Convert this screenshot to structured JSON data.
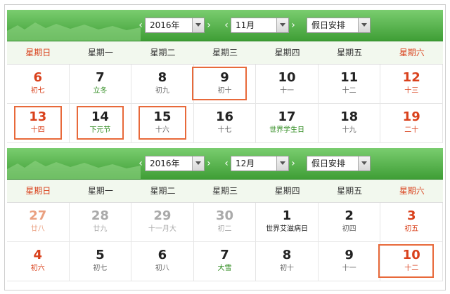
{
  "top": {
    "year": "2016年",
    "month": "11月",
    "holiday_label": "假日安排",
    "weekdays": [
      "星期日",
      "星期一",
      "星期二",
      "星期三",
      "星期四",
      "星期五",
      "星期六"
    ],
    "rows": [
      [
        {
          "day": "6",
          "lunar": "初七"
        },
        {
          "day": "7",
          "lunar": "立冬"
        },
        {
          "day": "8",
          "lunar": "初九"
        },
        {
          "day": "9",
          "lunar": "初十"
        },
        {
          "day": "10",
          "lunar": "十一"
        },
        {
          "day": "11",
          "lunar": "十二"
        },
        {
          "day": "12",
          "lunar": "十三"
        }
      ],
      [
        {
          "day": "13",
          "lunar": "十四"
        },
        {
          "day": "14",
          "lunar": "下元节"
        },
        {
          "day": "15",
          "lunar": "十六"
        },
        {
          "day": "16",
          "lunar": "十七"
        },
        {
          "day": "17",
          "lunar": "世界学生日"
        },
        {
          "day": "18",
          "lunar": "十九"
        },
        {
          "day": "19",
          "lunar": "二十"
        }
      ]
    ]
  },
  "bottom": {
    "year": "2016年",
    "month": "12月",
    "holiday_label": "假日安排",
    "weekdays": [
      "星期日",
      "星期一",
      "星期二",
      "星期三",
      "星期四",
      "星期五",
      "星期六"
    ],
    "rows": [
      [
        {
          "day": "27",
          "lunar": "廿八"
        },
        {
          "day": "28",
          "lunar": "廿九"
        },
        {
          "day": "29",
          "lunar": "十一月大"
        },
        {
          "day": "30",
          "lunar": "初二"
        },
        {
          "day": "1",
          "lunar": "世界艾滋病日"
        },
        {
          "day": "2",
          "lunar": "初四"
        },
        {
          "day": "3",
          "lunar": "初五"
        }
      ],
      [
        {
          "day": "4",
          "lunar": "初六"
        },
        {
          "day": "5",
          "lunar": "初七"
        },
        {
          "day": "6",
          "lunar": "初八"
        },
        {
          "day": "7",
          "lunar": "大雪"
        },
        {
          "day": "8",
          "lunar": "初十"
        },
        {
          "day": "9",
          "lunar": "十一"
        },
        {
          "day": "10",
          "lunar": "十二"
        }
      ]
    ]
  },
  "colors": {
    "header_green": "#4fae46",
    "weekend_red": "#d9411c",
    "highlight_orange": "#e8693a",
    "term_green": "#2e8b1e"
  }
}
